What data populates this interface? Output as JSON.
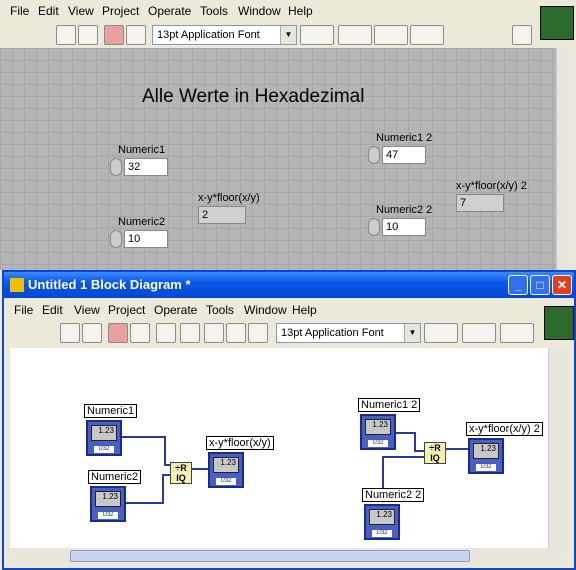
{
  "menu": [
    "File",
    "Edit",
    "View",
    "Project",
    "Operate",
    "Tools",
    "Window",
    "Help"
  ],
  "font_select": "13pt Application Font",
  "front_panel": {
    "heading": "Alle Werte in Hexadezimal",
    "numeric1": {
      "label": "Numeric1",
      "value": "32"
    },
    "numeric2": {
      "label": "Numeric2",
      "value": "10"
    },
    "result1": {
      "label": "x-y*floor(x/y)",
      "value": "2"
    },
    "numeric1_2": {
      "label": "Numeric1 2",
      "value": "47"
    },
    "numeric2_2": {
      "label": "Numeric2 2",
      "value": "10"
    },
    "result2": {
      "label": "x-y*floor(x/y) 2",
      "value": "7"
    }
  },
  "block_diagram": {
    "title": "Untitled 1 Block Diagram *",
    "terminals": {
      "numeric1": "Numeric1",
      "numeric2": "Numeric2",
      "result1": "x-y*floor(x/y)",
      "numeric1_2": "Numeric1 2",
      "numeric2_2": "Numeric2 2",
      "result2": "x-y*floor(x/y) 2"
    },
    "terminal_value_glyph": "1.23",
    "terminal_type": "U32"
  }
}
